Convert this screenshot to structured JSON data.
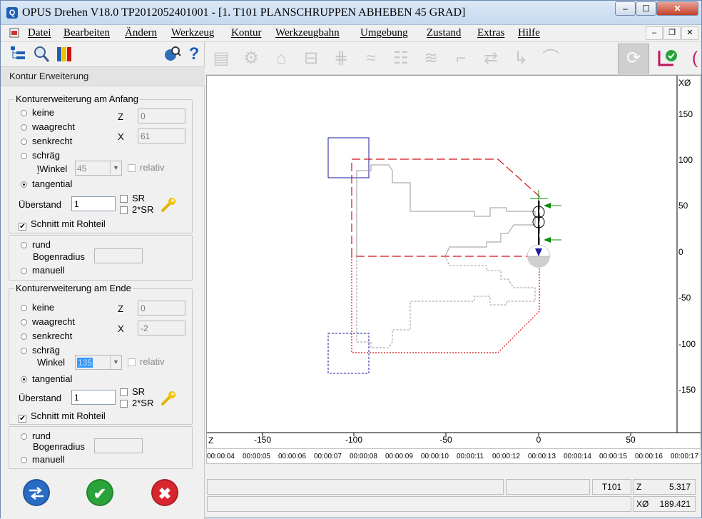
{
  "titlebar": {
    "title": "OPUS Drehen V18.0   TP2012052401001    - [1. T101 PLANSCHRUPPEN ABHEBEN 45 GRAD]",
    "min": "–",
    "max": "☐",
    "close": "✕"
  },
  "menu": {
    "items": [
      "Datei",
      "Bearbeiten",
      "Ändern",
      "Werkzeug",
      "Kontur",
      "Werkzeugbahn",
      "Umgebung",
      "Zustand",
      "Extras",
      "Hilfe"
    ],
    "mdi_min": "–",
    "mdi_restore": "❐",
    "mdi_close": "✕"
  },
  "panel": {
    "caption": "Kontur Erweiterung",
    "start": {
      "title": "Konturerweiterung am Anfang",
      "opt_keine": "keine",
      "opt_waagrecht": "waagrecht",
      "opt_senkrecht": "senkrecht",
      "opt_schraeg": "schräg",
      "winkel_label": "Winkel",
      "winkel_value": "45",
      "relativ": "relativ",
      "opt_tangential": "tangential",
      "z_label": "Z",
      "z_value": "0",
      "x_label": "X",
      "x_value": "61",
      "ueberstand_label": "Überstand",
      "ueberstand_value": "1",
      "sr": "SR",
      "sr2": "2*SR",
      "schnitt": "Schnitt mit Rohteil",
      "rund": "rund",
      "bogenradius": "Bogenradius",
      "manuell": "manuell"
    },
    "end": {
      "title": "Konturerweiterung am Ende",
      "opt_keine": "keine",
      "opt_waagrecht": "waagrecht",
      "opt_senkrecht": "senkrecht",
      "opt_schraeg": "schräg",
      "winkel_label": "Winkel",
      "winkel_value": "135",
      "relativ": "relativ",
      "opt_tangential": "tangential",
      "z_label": "Z",
      "z_value": "0",
      "x_label": "X",
      "x_value": "-2",
      "ueberstand_label": "Überstand",
      "ueberstand_value": "1",
      "sr": "SR",
      "sr2": "2*SR",
      "schnitt": "Schnitt mit Rohteil",
      "rund": "rund",
      "bogenradius": "Bogenradius",
      "manuell": "manuell"
    },
    "buttons": {
      "transfer_icon": "transfer-icon",
      "ok_icon": "checkmark-icon",
      "cancel_icon": "cancel-icon"
    }
  },
  "toolbar": {
    "icons": [
      "machine-icon",
      "turret-icon",
      "chuck-icon",
      "part-icon",
      "stock-icon",
      "contour-icon",
      "tool-list-icon",
      "toolpath-icon",
      "tool-icon",
      "shift-icon",
      "profile-icon",
      "curve-icon",
      "rotate-icon",
      "simulation-icon"
    ]
  },
  "plot": {
    "x_axis_label": "Z",
    "y_axis_label": "XØ",
    "x_ticks": [
      "-150",
      "-100",
      "-50",
      "0",
      "50"
    ],
    "y_ticks": [
      "150",
      "100",
      "50",
      "0",
      "-50",
      "-100",
      "-150"
    ]
  },
  "timeline": {
    "ticks": [
      "00:00:04",
      "00:00:05",
      "00:00:06",
      "00:00:07",
      "00:00:08",
      "00:00:09",
      "00:00:10",
      "00:00:11",
      "00:00:12",
      "00:00:13",
      "00:00:14",
      "00:00:15",
      "00:00:16",
      "00:00:17"
    ]
  },
  "status": {
    "tool": "T101",
    "z_label": "Z",
    "z_value": "5.317",
    "x_label": "XØ",
    "x_value": "189.421"
  },
  "colors": {
    "stock": "#d01010",
    "chuck": "#1a1aa0",
    "contour": "#999999",
    "arrow": "#0a8a0a"
  }
}
